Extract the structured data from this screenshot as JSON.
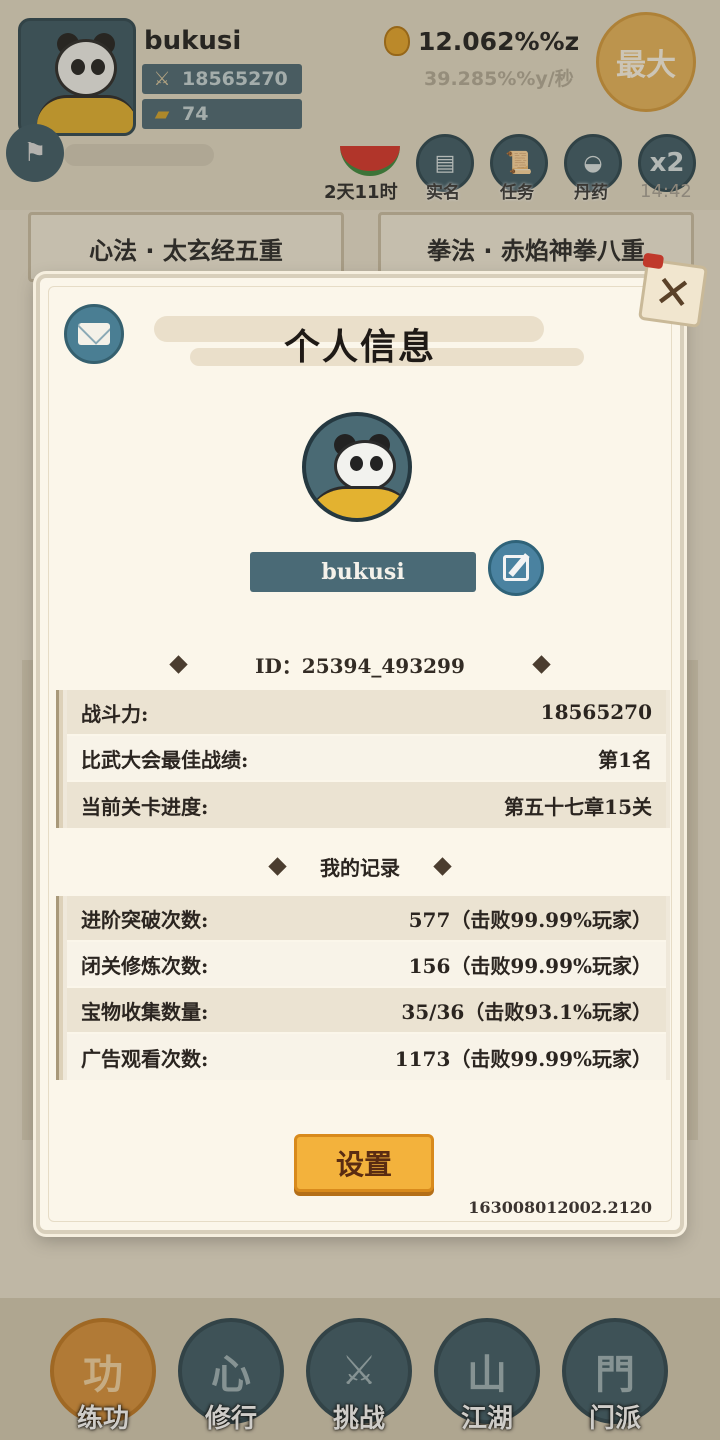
{
  "hud": {
    "player_name": "bukusi",
    "power": "18565270",
    "gold": "74",
    "currency": "12.062%%z",
    "rate": "39.285%%y/秒",
    "max_button": "最大",
    "event_timer": "2天11时",
    "x2_label": "x2",
    "x2_timer": "14:42",
    "tools": [
      {
        "label": "实名",
        "icon": "id-card-icon"
      },
      {
        "label": "任务",
        "icon": "scroll-icon"
      },
      {
        "label": "丹药",
        "icon": "pill-icon"
      }
    ]
  },
  "skills": {
    "left": "心法 · 太玄经五重",
    "right": "拳法 · 赤焰神拳八重"
  },
  "nav": [
    {
      "label": "练功",
      "glyph": "功"
    },
    {
      "label": "修行",
      "glyph": "心"
    },
    {
      "label": "挑战",
      "glyph": "⚔"
    },
    {
      "label": "江湖",
      "glyph": "山"
    },
    {
      "label": "门派",
      "glyph": "門"
    }
  ],
  "modal": {
    "title": "个人信息",
    "close_glyph": "✕",
    "username": "bukusi",
    "id_text": "ID：25394_493299",
    "stats": [
      {
        "label": "战斗力:",
        "value": "18565270"
      },
      {
        "label": "比武大会最佳战绩:",
        "value": "第1名"
      },
      {
        "label": "当前关卡进度:",
        "value": "第五十七章15关"
      }
    ],
    "records_title": "我的记录",
    "records": [
      {
        "label": "进阶突破次数:",
        "value": "577（击败99.99%玩家）"
      },
      {
        "label": "闭关修炼次数:",
        "value": "156（击败99.99%玩家）"
      },
      {
        "label": "宝物收集数量:",
        "value": "35/36（击败93.1%玩家）"
      },
      {
        "label": "广告观看次数:",
        "value": "1173（击败99.99%玩家）"
      }
    ],
    "settings_label": "设置",
    "version": "163008012002.2120"
  },
  "colors": {
    "accent_orange": "#f3b23c",
    "slate_blue": "#4a6a76",
    "paper": "#fbf6ea"
  }
}
